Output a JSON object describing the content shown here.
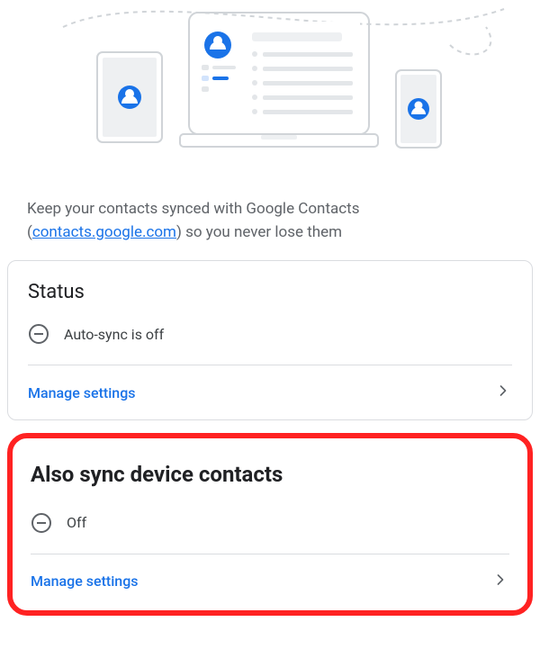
{
  "intro": {
    "text_before": "Keep your contacts synced with Google Contacts (",
    "link_text": "contacts.google.com",
    "text_after": ") so you never lose them"
  },
  "sections": {
    "status": {
      "title": "Status",
      "value": "Auto-sync is off",
      "action": "Manage settings"
    },
    "device": {
      "title": "Also sync device contacts",
      "value": "Off",
      "action": "Manage settings"
    }
  }
}
